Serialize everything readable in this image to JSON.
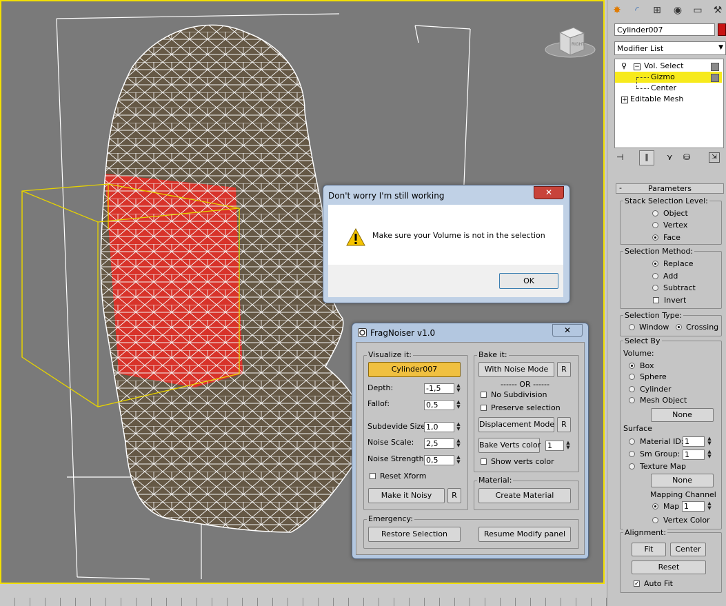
{
  "viewport": {
    "viewcube_label": "RIGHT"
  },
  "panel": {
    "toolbar_icons": [
      "create-icon",
      "modify-icon",
      "hierarchy-icon",
      "motion-icon",
      "display-icon",
      "utilities-icon"
    ],
    "object_name": "Cylinder007",
    "object_color": "#c81414",
    "modifier_list": "Modifier List",
    "stack": [
      {
        "label": "Vol. Select"
      },
      {
        "label": "Gizmo"
      },
      {
        "label": "Center"
      },
      {
        "label": "Editable Mesh"
      }
    ],
    "rollout_title": "Parameters",
    "stack_selection_level": {
      "title": "Stack Selection Level:",
      "options": [
        "Object",
        "Vertex",
        "Face"
      ],
      "selected": "Face"
    },
    "selection_method": {
      "title": "Selection Method:",
      "options": [
        "Replace",
        "Add",
        "Subtract"
      ],
      "selected": "Replace",
      "invert": "Invert"
    },
    "selection_type": {
      "title": "Selection Type:",
      "options": [
        "Window",
        "Crossing"
      ],
      "selected": "Crossing"
    },
    "select_by": {
      "title": "Select By",
      "volume_label": "Volume:",
      "volumes": [
        "Box",
        "Sphere",
        "Cylinder",
        "Mesh Object"
      ],
      "selected": "Box",
      "none1": "None",
      "surface_label": "Surface",
      "material_id": "Material ID:",
      "material_id_val": "1",
      "sm_group": "Sm Group:",
      "sm_group_val": "1",
      "texture_map": "Texture Map",
      "none2": "None",
      "mapping_channel": "Mapping Channel",
      "map": "Map",
      "map_val": "1",
      "vertex_color": "Vertex Color"
    },
    "alignment": {
      "title": "Alignment:",
      "fit": "Fit",
      "center": "Center",
      "reset": "Reset",
      "auto_fit": "Auto Fit"
    }
  },
  "dialog1": {
    "title": "Don't worry I'm still working",
    "close": "✕",
    "message": "Make sure your Volume is not in the selection",
    "ok": "OK"
  },
  "dialog2": {
    "title": "FragNoiser  v1.0",
    "close": "✕",
    "visualize": {
      "title": "Visualize it:",
      "object_button": "Cylinder007",
      "depth_label": "Depth:",
      "depth": "-1,5",
      "falloff_label": "Fallof:",
      "falloff": "0,5",
      "subdiv_label": "Subdevide Size:",
      "subdiv": "1,0",
      "noise_scale_label": "Noise Scale:",
      "noise_scale": "2,5",
      "noise_strength_label": "Noise Strength:",
      "noise_strength": "0,5",
      "reset_xform": "Reset Xform",
      "make_noisy": "Make it Noisy",
      "r": "R"
    },
    "bake": {
      "title": "Bake it:",
      "noise_mode": "With Noise Mode",
      "r": "R",
      "or": "------ OR ------",
      "no_subdivision": "No Subdivision",
      "preserve_selection": "Preserve selection",
      "displacement_mode": "Displacement Mode",
      "bake_verts": "Bake Verts color",
      "bake_val": "1",
      "show_verts": "Show verts color"
    },
    "material": {
      "title": "Material:",
      "create": "Create Material"
    },
    "emergency": {
      "title": "Emergency:",
      "restore": "Restore Selection",
      "resume": "Resume Modify panel"
    }
  }
}
